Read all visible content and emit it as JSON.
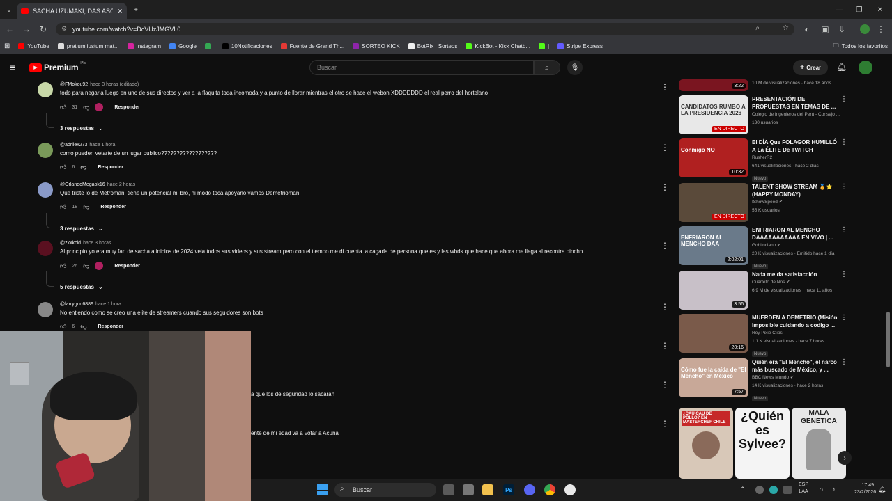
{
  "browser": {
    "tab_title": "SACHA UZUMAKI, DAS ASCO",
    "url": "youtube.com/watch?v=DcVUzJMGVL0",
    "bookmarks": [
      {
        "label": "YouTube",
        "color": "#ff0000"
      },
      {
        "label": "pretium iustum mat...",
        "color": "#dddddd"
      },
      {
        "label": "Instagram",
        "color": "#d6249f"
      },
      {
        "label": "Google",
        "color": "#4285f4"
      },
      {
        "label": "",
        "color": "#34a853"
      },
      {
        "label": "10Notificaciones",
        "color": "#000000"
      },
      {
        "label": "Fuente de Grand Th...",
        "color": "#e53935"
      },
      {
        "label": "SORTEO KICK",
        "color": "#8e24aa"
      },
      {
        "label": "BotRix | Sorteos",
        "color": "#eeeeee"
      },
      {
        "label": "KickBot - Kick Chatb...",
        "color": "#53fc18"
      },
      {
        "label": "|",
        "color": "#53fc18"
      },
      {
        "label": "Stripe Express",
        "color": "#635bff"
      }
    ],
    "all_favorites": "Todos los favoritos"
  },
  "youtube": {
    "logo": "Premium",
    "region": "PE",
    "search_placeholder": "Buscar",
    "create_label": "Crear"
  },
  "comments": [
    {
      "user": "@FMokou92",
      "time": "hace 3 horas (editado)",
      "text": "todo para negarla luego en uno de sus directos y ver a la flaquita toda incomoda y a punto de llorar mientras el otro se hace el webon XDDDDDDD el real perro del hortelano",
      "likes": "31",
      "reply": "Responder",
      "avatar_color": "#c8d8a8",
      "replies": "3 respuestas"
    },
    {
      "user": "@adrilex273",
      "time": "hace 1 hora",
      "text": "como pueden vetarte de un lugar publico??????????????????",
      "likes": "6",
      "reply": "Responder",
      "avatar_color": "#7a9a5a",
      "replies": ""
    },
    {
      "user": "@OrlandoMegaok16",
      "time": "hace 2 horas",
      "text": "Que triste lo de Metroman, tiene un potencial mi bro, ni modo toca apoyarlo vamos Demetrioman",
      "likes": "18",
      "reply": "Responder",
      "avatar_color": "#8a9ac8",
      "replies": "3 respuestas"
    },
    {
      "user": "@zkxkcid",
      "time": "hace 3 horas",
      "text": "Al principio yo era muy fan de sacha a inicios de 2024 veia todos sus videos y sus stream pero con el tiempo me di cuenta la cagada de persona que es y las wbds que hace que ahora me llega al recontra pincho",
      "likes": "26",
      "reply": "Responder",
      "avatar_color": "#5a1020",
      "replies": "5 respuestas"
    },
    {
      "user": "@larrygod6889",
      "time": "hace 1 hora",
      "text": "No entiendo como se creo una elite de streamers cuando sus seguidores son bots",
      "likes": "6",
      "reply": "Responder",
      "avatar_color": "#888888",
      "replies": ""
    }
  ],
  "partial_comments": [
    "a que los de seguridad lo sacaran",
    "ente de mi edad va a votar a Acuña"
  ],
  "sidebar": [
    {
      "title": "",
      "channel": "",
      "stats": "10 M de visualizaciones · hace 18 años",
      "duration": "3:22",
      "live": "",
      "badge": "",
      "thumb": "#7a1520"
    },
    {
      "title": "PRESENTACIÓN DE PROPUESTAS EN TEMAS DE ...",
      "channel": "Colegio de Ingenieros del Perú - Consejo ...",
      "stats": "130 usuarios",
      "duration": "",
      "live": "EN DIRECTO",
      "badge": "",
      "thumb": "#e8e8e8",
      "thumb_text": "CANDIDATOS RUMBO A LA PRESIDENCIA 2026"
    },
    {
      "title": "El DÍA Que FOLAGOR HUMILLÓ A La ÉLITE De TWITCH",
      "channel": "RusherR2",
      "stats": "641 visualizaciones · hace 2 días",
      "duration": "10:32",
      "live": "",
      "badge": "Nuevo",
      "thumb": "#b02020",
      "thumb_text": "Conmigo NO"
    },
    {
      "title": "TALENT SHOW STREAM 🏅⭐ (HAPPY MONDAY)",
      "channel": "IShowSpeed ✔",
      "stats": "55 K usuarios",
      "duration": "",
      "live": "EN DIRECTO",
      "badge": "",
      "thumb": "#5a4a3a"
    },
    {
      "title": "ENFRIARON AL MENCHO DAAAAAAAAAAA EN VIVO | ...",
      "channel": "Goblinciano ✔",
      "stats": "20 K visualizaciones · Emitido hace 1 día",
      "duration": "2:02:01",
      "live": "",
      "badge": "Nuevo",
      "thumb": "#6a7a8a",
      "thumb_text": "ENFRIARON AL MENCHO DAA"
    },
    {
      "title": "Nada me da satisfacción",
      "channel": "Cuarteto de Nos ✔",
      "stats": "6,9 M de visualizaciones · hace 11 años",
      "duration": "3:56",
      "live": "",
      "badge": "",
      "thumb": "#c8c0c8"
    },
    {
      "title": "MUERDEN A DEMETRIO (Misión Imposible cuidando a codigo ...",
      "channel": "Rey Pixie Clips",
      "stats": "1,1 K visualizaciones · hace 7 horas",
      "duration": "20:16",
      "live": "",
      "badge": "Nuevo",
      "thumb": "#7a5a4a"
    },
    {
      "title": "Quién era \"El Mencho\", el narco más buscado de México, y ...",
      "channel": "BBC News Mundo ✔",
      "stats": "14 K visualizaciones · hace 2 horas",
      "duration": "7:57",
      "live": "",
      "badge": "Nuevo",
      "thumb": "#c8a898",
      "thumb_text": "Cómo fue la caída de \"El Mencho\" en México"
    }
  ],
  "shorts": [
    {
      "text": "¿CAU CAU DE POLLO? EN MASTERCHEF CHILE",
      "color": "#d8c8b8"
    },
    {
      "text": "¿Quién es Sylvee?",
      "color": "#f4f4f4"
    },
    {
      "text": "MALA GENETICA",
      "color": "#e8e8e8"
    }
  ],
  "taskbar": {
    "search": "Buscar",
    "lang": "ESP",
    "layout": "LAA",
    "time": "17:49",
    "date": "23/2/2026"
  }
}
